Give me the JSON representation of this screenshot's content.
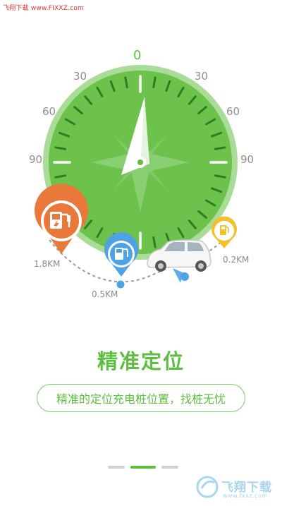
{
  "watermark_top": "飞翔下载 www.FIXXZ.com",
  "compass": {
    "deg_top": "0",
    "deg_30_left": "30",
    "deg_30_right": "30",
    "deg_60_left": "60",
    "deg_60_right": "60",
    "deg_90_left": "90",
    "deg_90_right": "90"
  },
  "stations": [
    {
      "distance": "1.8KM",
      "color": "#e8793a",
      "icon": "charging-pump-icon"
    },
    {
      "distance": "0.5KM",
      "color": "#4da3e6",
      "icon": "charging-pump-icon"
    },
    {
      "distance": "0.2KM",
      "color": "#f0c22e",
      "icon": "fuel-pump-icon"
    }
  ],
  "feature": {
    "title": "精准定位",
    "subtitle": "精准的定位充电桩位置，找桩无忧"
  },
  "pager": {
    "total": 3,
    "active_index": 1
  },
  "watermark_bottom": {
    "logo_text": "飞翔下载",
    "url": "www.fxxz.com"
  },
  "colors": {
    "accent": "#5cbf40",
    "compass_fill": "#6cc24a",
    "compass_ring": "#8fd17a"
  }
}
